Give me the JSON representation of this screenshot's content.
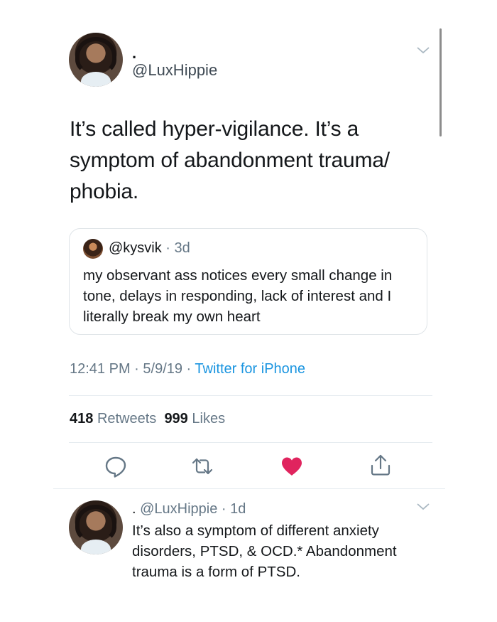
{
  "tweet": {
    "display_name": ".",
    "handle": "@LuxHippie",
    "text": "It’s called hyper-vigilance. It’s a symptom of abandonment trauma/ phobia.",
    "time": "12:41 PM",
    "date": "5/9/19",
    "source": "Twitter for iPhone",
    "retweet_count": "418",
    "retweet_label": "Retweets",
    "like_count": "999",
    "like_label": "Likes"
  },
  "quoted_tweet": {
    "handle": "@kysvik",
    "age": "3d",
    "text": "my observant ass notices every small change in tone, delays in responding, lack of interest and I literally break my own heart"
  },
  "reply": {
    "display_name": ".",
    "handle": "@LuxHippie",
    "age": "1d",
    "text": "It’s also a symptom of different anxiety disorders, PTSD, & OCD.* Abandonment trauma is a form of PTSD."
  },
  "actions": {
    "reply_icon": "reply-icon",
    "retweet_icon": "retweet-icon",
    "like_icon": "heart-icon",
    "share_icon": "share-icon"
  },
  "colors": {
    "like": "#e0245e",
    "link": "#1b95e0",
    "secondary_text": "#657786",
    "divider": "#e6ecf0"
  }
}
